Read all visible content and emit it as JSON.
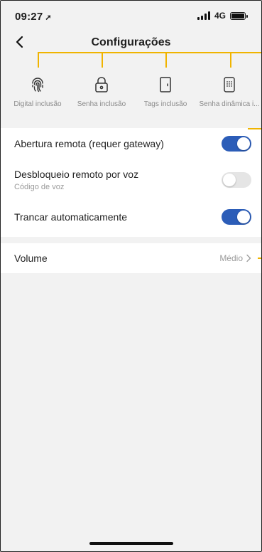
{
  "status": {
    "time": "09:27",
    "network": "4G"
  },
  "nav": {
    "title": "Configurações"
  },
  "shortcuts": [
    {
      "label": "Digital inclusão",
      "icon": "fingerprint-icon"
    },
    {
      "label": "Senha inclusão",
      "icon": "lock-icon"
    },
    {
      "label": "Tags inclusão",
      "icon": "door-icon"
    },
    {
      "label": "Senha dinâmica i...",
      "icon": "keypad-icon"
    }
  ],
  "settings": {
    "remote_open": {
      "label": "Abertura remota (requer gateway)",
      "enabled": true
    },
    "voice_unlock": {
      "label": "Desbloqueio remoto por voz",
      "sublabel": "Código de voz",
      "enabled": false
    },
    "auto_lock": {
      "label": "Trancar automaticamente",
      "enabled": true
    },
    "volume": {
      "label": "Volume",
      "value": "Médio"
    }
  },
  "colors": {
    "toggle_on": "#2c5db8",
    "annotation": "#f0b400",
    "background": "#f2f2f2"
  }
}
